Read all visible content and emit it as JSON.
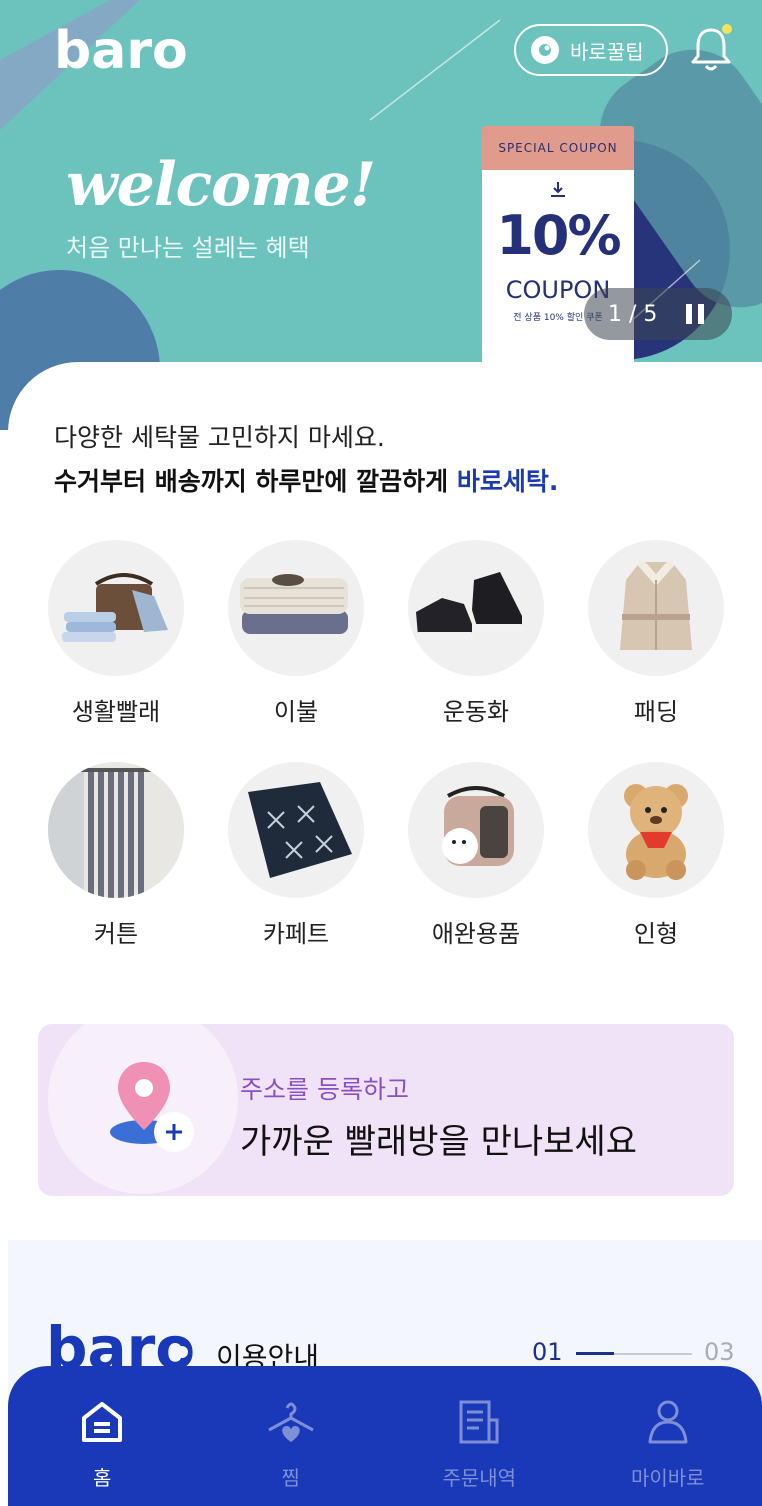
{
  "header": {
    "logo_text": "baro",
    "tips_label": "바로꿀팁"
  },
  "hero": {
    "title": "welcome!",
    "subtitle": "처음 만나는 설레는 혜택",
    "coupon": {
      "tag": "SPECIAL COUPON",
      "amount": "10%",
      "word": "COUPON",
      "note": "전 상품 10% 할인 쿠폰"
    },
    "pager": "1 / 5"
  },
  "intro": {
    "line1": "다양한 세탁물 고민하지 마세요.",
    "line2_prefix": "수거부터 배송까지 하루만에 깔끔하게 ",
    "line2_brand": "바로세탁."
  },
  "categories": [
    {
      "label": "생활빨래",
      "icon": "laundry-basket-icon"
    },
    {
      "label": "이불",
      "icon": "blanket-icon"
    },
    {
      "label": "운동화",
      "icon": "sneakers-icon"
    },
    {
      "label": "패딩",
      "icon": "coat-icon"
    },
    {
      "label": "커튼",
      "icon": "curtain-icon"
    },
    {
      "label": "카페트",
      "icon": "carpet-icon"
    },
    {
      "label": "애완용품",
      "icon": "pet-carrier-icon"
    },
    {
      "label": "인형",
      "icon": "teddy-bear-icon"
    }
  ],
  "address_banner": {
    "line1": "주소를 등록하고",
    "line2": "가까운 빨래방을 만나보세요"
  },
  "guide": {
    "logo_text": "baro",
    "title": "이용안내",
    "current": "01",
    "total": "03"
  },
  "nav": [
    {
      "label": "홈",
      "icon": "home-icon",
      "active": true
    },
    {
      "label": "찜",
      "icon": "hanger-heart-icon",
      "active": false
    },
    {
      "label": "주문내역",
      "icon": "receipt-icon",
      "active": false
    },
    {
      "label": "마이바로",
      "icon": "person-icon",
      "active": false
    }
  ],
  "colors": {
    "hero_bg": "#6cc3bd",
    "brand_blue": "#1a39b8",
    "banner_bg": "#f1e3f7",
    "accent_purple": "#8a4fc4"
  }
}
